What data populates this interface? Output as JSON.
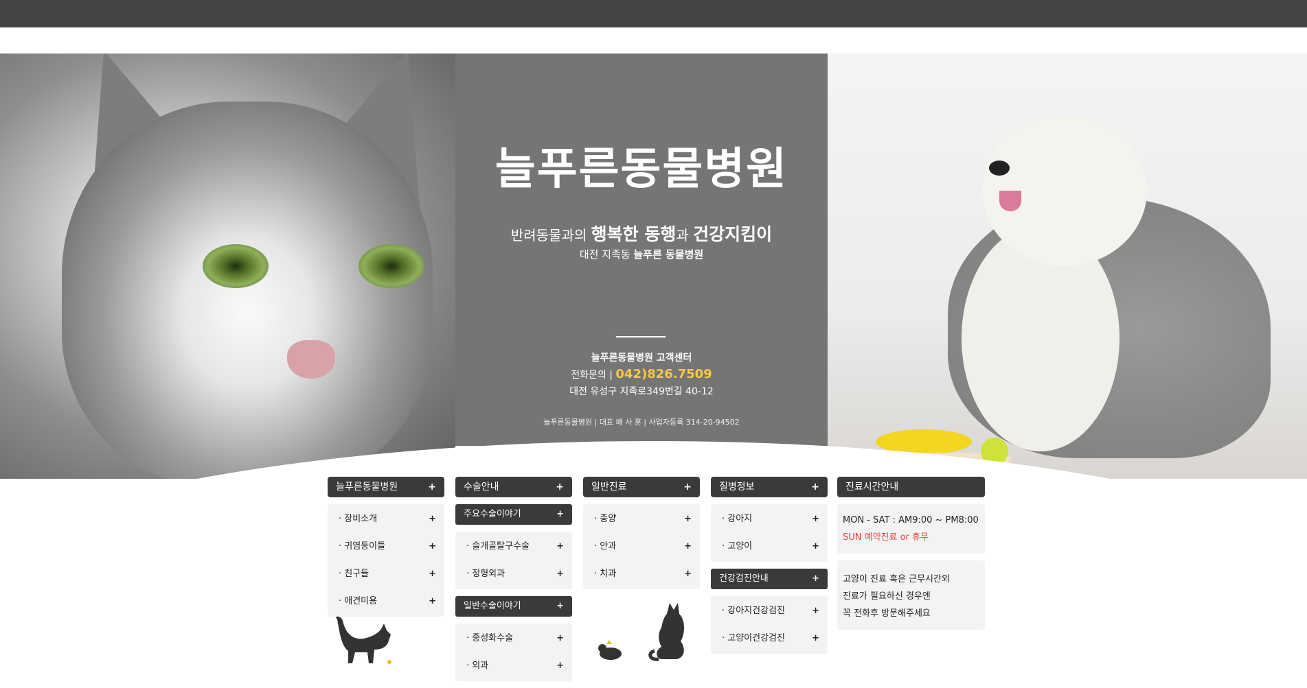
{
  "hero": {
    "logo": "늘푸른동물병원",
    "tagline_prefix": "반려동물과의 ",
    "tagline_bold1": "행복한 동행",
    "tagline_mid": "과 ",
    "tagline_bold2": "건강지킴이",
    "subtag_prefix": "대전 지족동 ",
    "subtag_bold": "늘푸른 동물병원"
  },
  "customer_center": {
    "title": "늘푸른동물병원 고객센터",
    "phone_label": "전화문의 | ",
    "phone": "042)826.7509",
    "address": "대전 유성구 지족로349번길 40-12",
    "business": "늘푸른동물병원 | 대표 배 사 훈 | 사업자등록 314-20-94502"
  },
  "menu": {
    "col1": {
      "header": "늘푸른동물병원",
      "items": [
        "· 장비소개",
        "· 귀염둥이들",
        "· 친구들",
        "· 애견미용"
      ]
    },
    "col2": {
      "header": "수술안내",
      "sub1": "주요수술이야기",
      "sub1_items": [
        "· 슬개골탈구수술",
        "· 정형외과"
      ],
      "sub2": "일반수술이야기",
      "sub2_items": [
        "· 중성화수술",
        "· 외과"
      ]
    },
    "col3": {
      "header": "일반진료",
      "items": [
        "· 종양",
        "· 안과",
        "· 치과"
      ]
    },
    "col4": {
      "header": "질병정보",
      "items": [
        "· 강아지",
        "· 고양이"
      ],
      "sub": "건강검진안내",
      "sub_items": [
        "· 강아지건강검진",
        "· 고양이건강검진"
      ]
    },
    "hours": {
      "header": "진료시간안내",
      "weekday": "MON - SAT : AM9:00 ~ PM8:00",
      "sunday": "SUN 예약진료 or 휴무",
      "note1": "고양이 진료 혹은 근무시간외",
      "note2": "진료가 필요하신 경우엔",
      "note3": "꼭 전화후 방문해주세요"
    },
    "plus": "+"
  },
  "colors": {
    "topbar": "#454545",
    "panel": "#6f6f70",
    "menu_header": "#3a3a3a",
    "accent_phone": "#f7c948",
    "sunday_red": "#e0433a"
  }
}
